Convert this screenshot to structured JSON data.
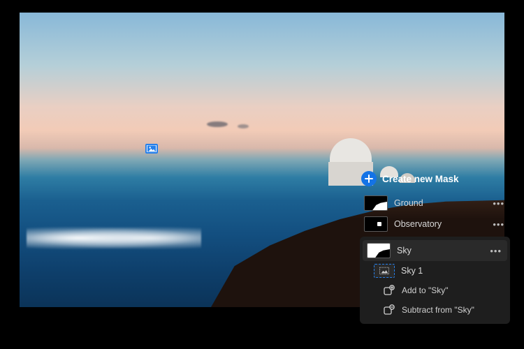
{
  "panel": {
    "create_label": "Create new Mask",
    "masks": [
      {
        "label": "Ground"
      },
      {
        "label": "Observatory"
      },
      {
        "label": "Sky"
      }
    ],
    "sky_children": {
      "child_label": "Sky 1",
      "add_label": "Add to \"Sky\"",
      "subtract_label": "Subtract from \"Sky\""
    }
  }
}
